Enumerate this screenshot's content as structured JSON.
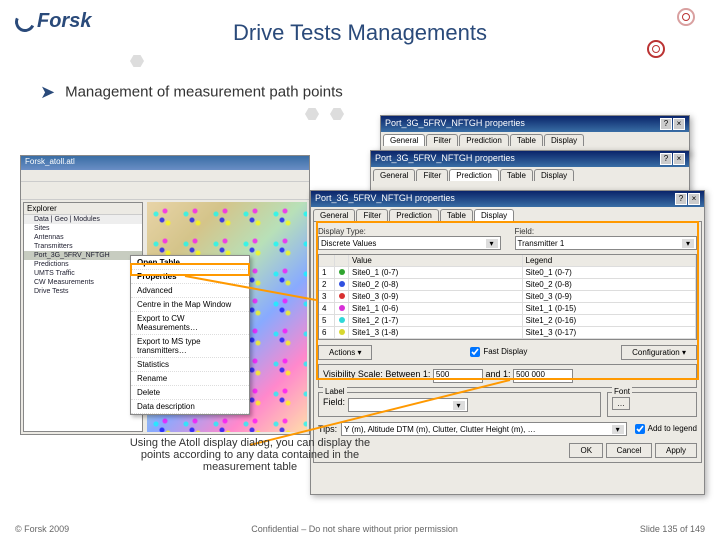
{
  "header": {
    "brand": "Forsk",
    "title": "Drive Tests Managements"
  },
  "subtitle": "Management of measurement path points",
  "app": {
    "window_title": "Forsk_atoll.atl",
    "explorer_title": "Explorer",
    "explorer_tabs": "Data | Geo | Modules",
    "tree": {
      "root": "Sites",
      "i1": "Antennas",
      "i2": "Transmitters",
      "i3": "Port_3G_5FRV_NFTGH",
      "i4": "Predictions",
      "i5": "UMTS Traffic",
      "i6": "CW Measurements",
      "i7": "Drive Tests"
    },
    "context_menu": {
      "m0": "Open Table",
      "m1": "Properties",
      "m2": "Advanced",
      "m3": "Centre in the Map Window",
      "m4": "Export to CW Measurements…",
      "m5": "Export to MS type transmitters…",
      "m6": "Statistics",
      "m7": "Rename",
      "m8": "Delete",
      "m9": "Data description"
    }
  },
  "dialogs": {
    "d1_title": "Port_3G_5FRV_NFTGH properties",
    "d2_title": "Port_3G_5FRV_NFTGH properties",
    "d3_title": "Port_3G_5FRV_NFTGH properties",
    "tabs": {
      "general": "General",
      "filter": "Filter",
      "prediction": "Prediction",
      "table": "Table",
      "display": "Display"
    },
    "display": {
      "display_type_label": "Display Type:",
      "display_type_value": "Discrete Values",
      "field_label": "Field:",
      "field_value": "Transmitter 1",
      "table": {
        "h_value": "Value",
        "h_legend": "Legend",
        "rows": [
          {
            "n": "1",
            "c": "#2fa42f",
            "v": "Site0_1 (0-7)",
            "l": "Site0_1 (0-7)"
          },
          {
            "n": "2",
            "c": "#3050e0",
            "v": "Site0_2 (0-8)",
            "l": "Site0_2 (0-8)"
          },
          {
            "n": "3",
            "c": "#d83030",
            "v": "Site0_3 (0-9)",
            "l": "Site0_3 (0-9)"
          },
          {
            "n": "4",
            "c": "#d830d8",
            "v": "Site1_1 (0-6)",
            "l": "Site1_1 (0-15)"
          },
          {
            "n": "5",
            "c": "#30d8d8",
            "v": "Site1_2 (1-7)",
            "l": "Site1_2 (0-16)"
          },
          {
            "n": "6",
            "c": "#d8d830",
            "v": "Site1_3 (1-8)",
            "l": "Site1_3 (0-17)"
          }
        ]
      },
      "actions_btn": "Actions",
      "fast_display": "Fast Display",
      "configuration_btn": "Configuration",
      "visibility_label": "Visibility Scale:",
      "between": "Between 1:",
      "between_val": "500",
      "and": "and 1:",
      "and_val": "500 000",
      "label_group": "Label",
      "field2": "Field:",
      "field2_val": "",
      "font_group": "Font",
      "tips_label": "Tips:",
      "tips_value": "Y (m), Altitude DTM (m), Clutter, Clutter Height (m), …",
      "add_legend": "Add to legend",
      "ok": "OK",
      "cancel": "Cancel",
      "apply": "Apply"
    }
  },
  "caption": "Using the Atoll display dialog, you can display the points according to any data contained in the measurement table",
  "footer": {
    "left": "© Forsk 2009",
    "center": "Confidential – Do not share without prior permission",
    "right": "Slide 135 of 149"
  }
}
